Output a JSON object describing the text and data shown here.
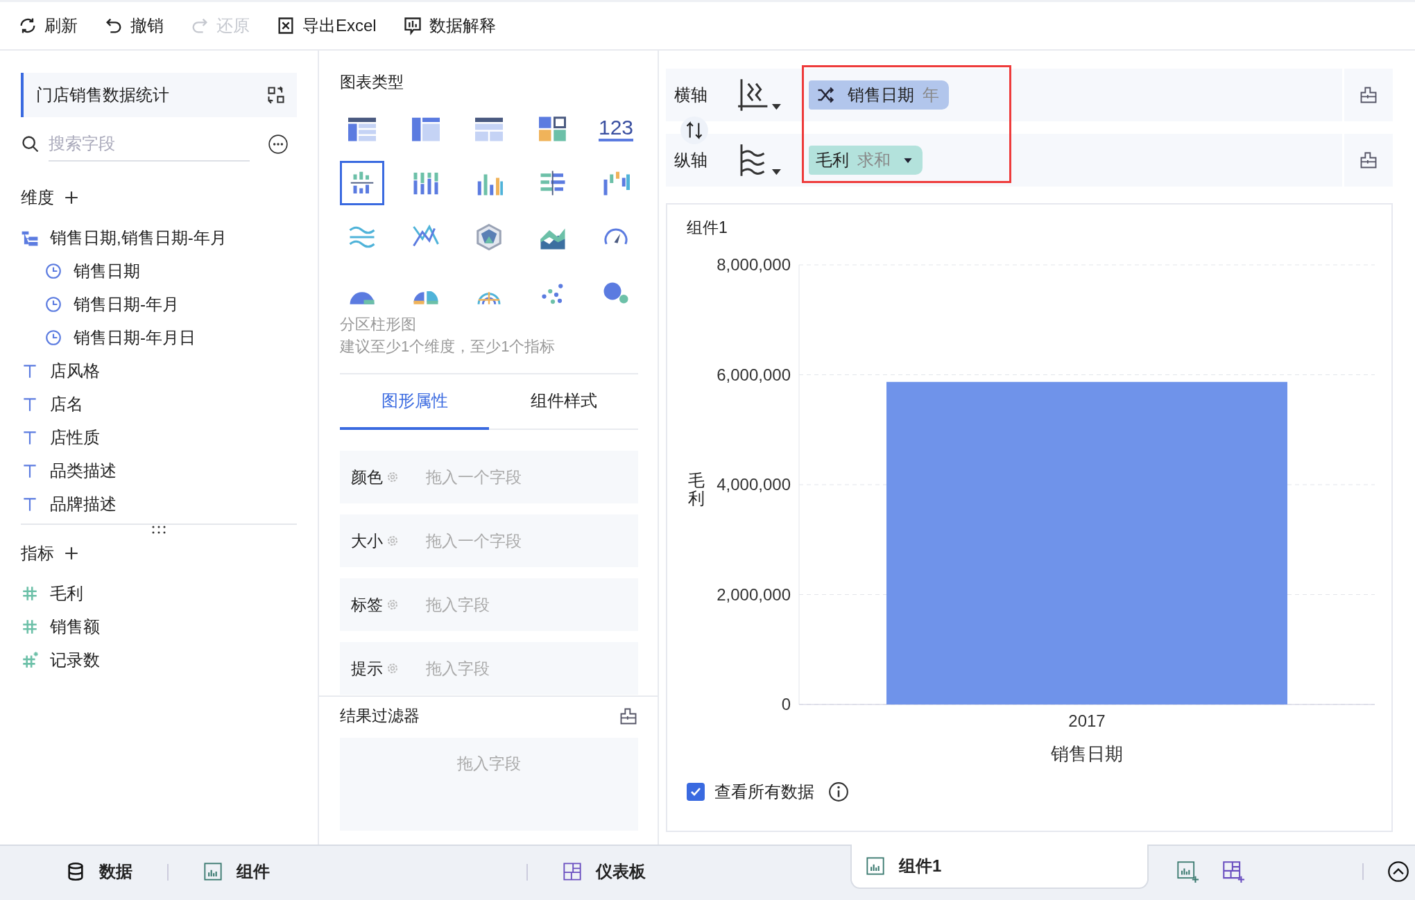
{
  "toolbar": [
    {
      "label": "刷新",
      "disabled": false
    },
    {
      "label": "撤销",
      "disabled": false
    },
    {
      "label": "还原",
      "disabled": true
    },
    {
      "label": "导出Excel",
      "disabled": false
    },
    {
      "label": "数据解释",
      "disabled": false
    }
  ],
  "data_panel": {
    "dataset": "门店销售数据统计",
    "search": {
      "placeholder": "搜索字段"
    },
    "dimensions": {
      "title": "维度",
      "items": [
        {
          "label": "销售日期,销售日期-年月",
          "kind": "hierarchy",
          "children": [
            {
              "label": "销售日期",
              "kind": "date"
            },
            {
              "label": "销售日期-年月",
              "kind": "date"
            },
            {
              "label": "销售日期-年月日",
              "kind": "date"
            }
          ]
        },
        {
          "label": "店风格",
          "kind": "text"
        },
        {
          "label": "店名",
          "kind": "text"
        },
        {
          "label": "店性质",
          "kind": "text"
        },
        {
          "label": "品类描述",
          "kind": "text"
        },
        {
          "label": "品牌描述",
          "kind": "text"
        }
      ]
    },
    "measures": {
      "title": "指标",
      "items": [
        {
          "label": "毛利",
          "kind": "number"
        },
        {
          "label": "销售额",
          "kind": "number"
        },
        {
          "label": "记录数",
          "kind": "count"
        }
      ]
    }
  },
  "chart_panel": {
    "title": "图表类型",
    "types": [
      {
        "selected": false
      },
      {
        "selected": false
      },
      {
        "selected": false
      },
      {
        "selected": false
      },
      {
        "selected": false,
        "text": "123"
      },
      {
        "selected": true
      },
      {
        "selected": false
      },
      {
        "selected": false
      },
      {
        "selected": false
      },
      {
        "selected": false
      },
      {
        "selected": false
      },
      {
        "selected": false
      },
      {
        "selected": false
      },
      {
        "selected": false
      },
      {
        "selected": false
      },
      {
        "selected": false
      },
      {
        "selected": false
      },
      {
        "selected": false
      },
      {
        "selected": false
      },
      {
        "selected": false
      }
    ],
    "chart_name": "分区柱形图",
    "hint": "建议至少1个维度，至少1个指标",
    "tabs": [
      {
        "label": "图形属性",
        "selected": true
      },
      {
        "label": "组件样式",
        "selected": false
      }
    ],
    "properties": [
      {
        "label": "颜色",
        "placeholder": "拖入一个字段"
      },
      {
        "label": "大小",
        "placeholder": "拖入一个字段"
      },
      {
        "label": "标签",
        "placeholder": "拖入字段"
      },
      {
        "label": "提示",
        "placeholder": "拖入字段"
      }
    ],
    "result_filter": {
      "title": "结果过滤器",
      "placeholder": "拖入字段"
    }
  },
  "axes": [
    {
      "label": "横轴",
      "field": "销售日期",
      "aggregation": "年",
      "color": "#b2c6ec",
      "dropdown": false
    },
    {
      "label": "纵轴",
      "field": "毛利",
      "aggregation": "求和",
      "color": "#b3e2dc",
      "dropdown": true
    }
  ],
  "widget": {
    "title": "组件1",
    "chart_data": {
      "type": "bar",
      "xlabel": "销售日期",
      "ylabel": "毛利",
      "categories": [
        "2017"
      ],
      "series": [
        {
          "color": "#6f93ea",
          "values": [
            5870000
          ]
        }
      ],
      "grid": true,
      "ylim": [
        0,
        8000000
      ],
      "yticks": [
        {
          "value": 0,
          "label": "0"
        },
        {
          "value": 2000000,
          "label": "2,000,000"
        },
        {
          "value": 4000000,
          "label": "4,000,000"
        },
        {
          "value": 6000000,
          "label": "6,000,000"
        },
        {
          "value": 8000000,
          "label": "8,000,000"
        }
      ]
    },
    "show_all_data": {
      "label": "查看所有数据",
      "checked": true
    }
  },
  "bottom_tabs": [
    {
      "label": "数据",
      "kind": "data",
      "selected": false
    },
    {
      "label": "组件",
      "kind": "widget",
      "selected": false
    },
    {
      "label": "仪表板",
      "kind": "dashboard",
      "selected": false
    },
    {
      "label": "组件1",
      "kind": "widget",
      "selected": true
    }
  ]
}
